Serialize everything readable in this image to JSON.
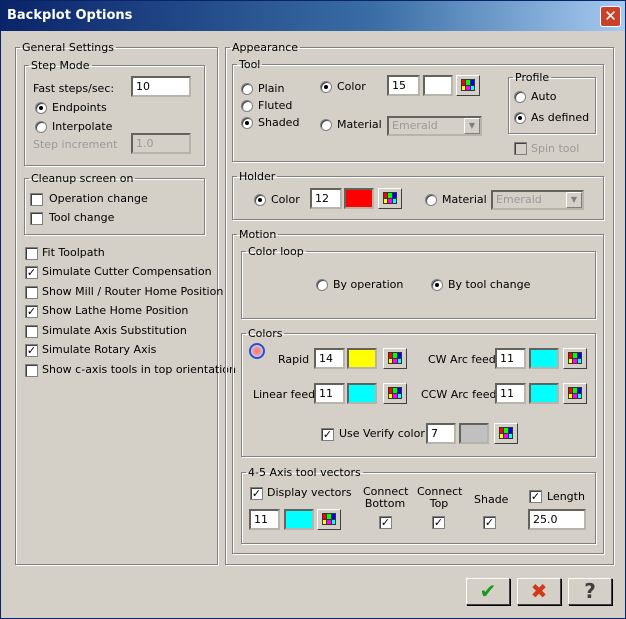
{
  "window": {
    "title": "Backplot Options"
  },
  "general": {
    "legend": "General Settings",
    "step_mode": {
      "legend": "Step Mode",
      "fast_steps_label": "Fast steps/sec:",
      "fast_steps_value": "10",
      "endpoints_label": "Endpoints",
      "interpolate_label": "Interpolate",
      "step_increment_label": "Step increment",
      "step_increment_value": "1.0",
      "selected": "Endpoints"
    },
    "cleanup": {
      "legend": "Cleanup screen on",
      "operation_change": "Operation change",
      "tool_change": "Tool change",
      "operation_change_checked": false,
      "tool_change_checked": false
    },
    "options": [
      {
        "label": "Fit Toolpath",
        "checked": false
      },
      {
        "label": "Simulate Cutter Compensation",
        "checked": true
      },
      {
        "label": "Show Mill / Router Home Position",
        "checked": false
      },
      {
        "label": "Show Lathe Home Position",
        "checked": true
      },
      {
        "label": "Simulate Axis Substitution",
        "checked": false
      },
      {
        "label": "Simulate Rotary Axis",
        "checked": true
      },
      {
        "label": "Show c-axis tools in top orientation",
        "checked": false
      }
    ]
  },
  "appearance": {
    "legend": "Appearance",
    "tool": {
      "legend": "Tool",
      "plain": "Plain",
      "fluted": "Fluted",
      "shaded": "Shaded",
      "selected_style": "Shaded",
      "color_label": "Color",
      "color_value": "15",
      "color_swatch": "#ffffff",
      "material_label": "Material",
      "material_value": "Emerald",
      "color_selected": true,
      "profile": {
        "legend": "Profile",
        "auto": "Auto",
        "as_defined": "As defined",
        "selected": "As defined"
      },
      "spin_tool": "Spin tool"
    },
    "holder": {
      "legend": "Holder",
      "color_label": "Color",
      "color_value": "12",
      "color_swatch": "#ff0000",
      "material_label": "Material",
      "material_value": "Emerald"
    },
    "motion": {
      "legend": "Motion",
      "color_loop": {
        "legend": "Color loop",
        "by_operation": "By operation",
        "by_tool_change": "By tool change",
        "selected": "By tool change"
      },
      "colors": {
        "legend": "Colors",
        "rapid_label": "Rapid",
        "rapid_value": "14",
        "rapid_swatch": "#ffff00",
        "linear_label": "Linear feed",
        "linear_value": "11",
        "linear_swatch": "#00ffff",
        "cw_label": "CW Arc feed",
        "cw_value": "11",
        "cw_swatch": "#00ffff",
        "ccw_label": "CCW Arc feed",
        "ccw_value": "11",
        "ccw_swatch": "#00ffff",
        "verify_label": "Use Verify color",
        "verify_value": "7",
        "verify_swatch": "#c0c0c0",
        "verify_checked": true
      },
      "vectors": {
        "legend": "4-5 Axis tool vectors",
        "display_label": "Display vectors",
        "display_checked": true,
        "vector_color_value": "11",
        "vector_swatch": "#00ffff",
        "connect_bottom_label": "Connect\nBottom",
        "connect_bottom_line1": "Connect",
        "connect_bottom_line2": "Bottom",
        "connect_top_line1": "Connect",
        "connect_top_line2": "Top",
        "shade_label": "Shade",
        "length_label": "Length",
        "length_value": "25.0",
        "connect_bottom_checked": true,
        "connect_top_checked": true,
        "shade_checked": true,
        "length_checked": true
      }
    }
  },
  "buttons": {
    "ok_glyph": "✔",
    "cancel_glyph": "✖",
    "help_glyph": "?"
  },
  "colors": {
    "ok_green": "#1a9a1a",
    "cancel_red": "#d03a1a",
    "help_gray": "#404040"
  }
}
